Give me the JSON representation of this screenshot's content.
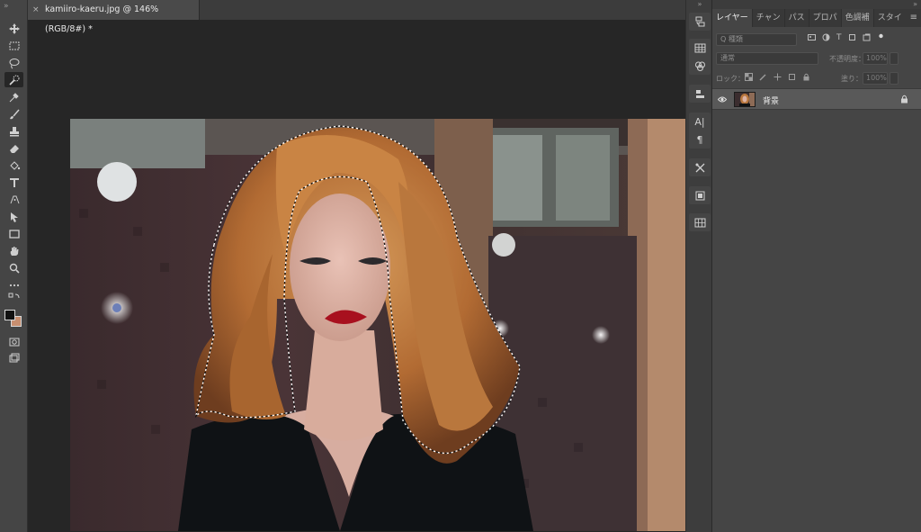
{
  "document": {
    "tab_title": "kamiiro-kaeru.jpg @ 146% (RGB/8#) *",
    "close_symbol": "×"
  },
  "toolbar": {
    "collapse_symbol": "»",
    "tools": [
      {
        "name": "move-tool-icon"
      },
      {
        "name": "marquee-tool-icon"
      },
      {
        "name": "lasso-tool-icon"
      },
      {
        "name": "quick-selection-tool-icon",
        "active": true
      },
      {
        "name": "eyedropper-tool-icon"
      },
      {
        "name": "brush-tool-icon"
      },
      {
        "name": "stamp-tool-icon"
      },
      {
        "name": "eraser-tool-icon"
      },
      {
        "name": "paint-bucket-tool-icon"
      },
      {
        "name": "type-tool-icon"
      },
      {
        "name": "pen-tool-icon"
      },
      {
        "name": "path-selection-tool-icon"
      },
      {
        "name": "rectangle-tool-icon"
      },
      {
        "name": "hand-tool-icon"
      },
      {
        "name": "zoom-tool-icon"
      },
      {
        "name": "more-tools-icon"
      }
    ],
    "foreground_color": "#111111",
    "background_color": "#c88f70"
  },
  "right_strip": {
    "collapse_symbol": "»",
    "char_icon": "A|",
    "para_icon": "¶"
  },
  "panel": {
    "collapse_symbol": "»",
    "tabs": [
      "レイヤー",
      "チャン",
      "パス",
      "プロパ",
      "色調補",
      "スタイ"
    ],
    "menu_symbol": "≡",
    "filter_placeholder": "Q 種類",
    "filter_type_icon": "T",
    "blend_mode": "通常",
    "opacity_label": "不透明度：",
    "opacity_value": "100%",
    "lock_label": "ロック：",
    "fill_label": "塗り：",
    "fill_value": "100%",
    "layers": [
      {
        "name": "背景",
        "visible": true,
        "locked": true
      }
    ]
  },
  "colors": {
    "accent_dark": "#262626",
    "panel_bg": "#454545",
    "selected_layer": "#595959"
  }
}
